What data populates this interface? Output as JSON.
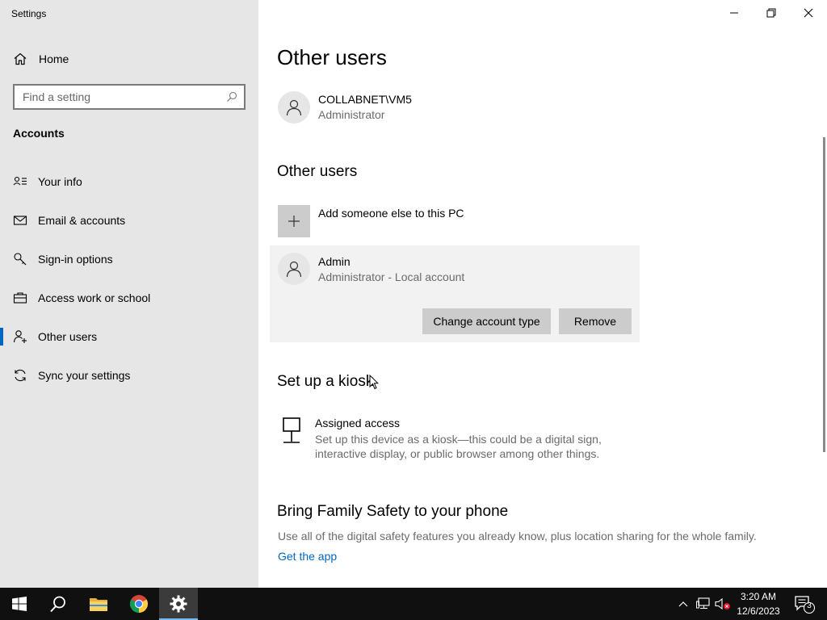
{
  "window": {
    "title": "Settings"
  },
  "sidebar": {
    "home_label": "Home",
    "search_placeholder": "Find a setting",
    "section_title": "Accounts",
    "items": [
      {
        "label": "Your info",
        "icon": "person-card-icon"
      },
      {
        "label": "Email & accounts",
        "icon": "mail-icon"
      },
      {
        "label": "Sign-in options",
        "icon": "key-icon"
      },
      {
        "label": "Access work or school",
        "icon": "briefcase-icon"
      },
      {
        "label": "Other users",
        "icon": "person-add-icon",
        "active": true
      },
      {
        "label": "Sync your settings",
        "icon": "sync-icon"
      }
    ]
  },
  "main": {
    "page_title": "Other users",
    "current_user": {
      "name": "COLLABNET\\VM5",
      "role": "Administrator"
    },
    "other_users": {
      "heading": "Other users",
      "add_label": "Add someone else to this PC",
      "selected_user": {
        "name": "Admin",
        "role": "Administrator - Local account"
      },
      "change_type_label": "Change account type",
      "remove_label": "Remove"
    },
    "kiosk": {
      "heading": "Set up a kiosk",
      "title": "Assigned access",
      "description_line1": "Set up this device as a kiosk—this could be a digital sign,",
      "description_line2": "interactive display, or public browser among other things."
    },
    "family": {
      "heading": "Bring Family Safety to your phone",
      "description": "Use all of the digital safety features you already know, plus location sharing for the whole family.",
      "link": "Get the app"
    }
  },
  "taskbar": {
    "time": "3:20 AM",
    "date": "12/6/2023",
    "notification_count": "3"
  },
  "colors": {
    "accent": "#0067c0",
    "sidebar_bg": "#e6e6e6",
    "taskbar_bg": "#101010"
  }
}
